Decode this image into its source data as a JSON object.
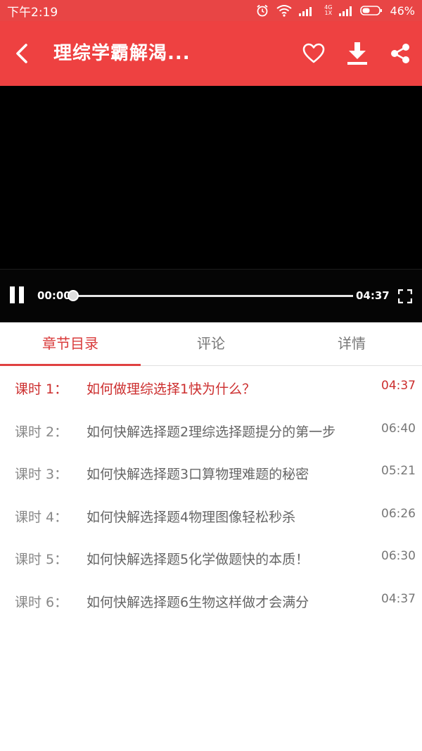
{
  "status_bar": {
    "time": "下午2:19",
    "network": "4G",
    "network_sub": "1X",
    "battery": "46%",
    "icons": [
      "alarm-icon",
      "wifi-icon",
      "signal-icon",
      "signal-icon",
      "battery-icon"
    ]
  },
  "header": {
    "title": "理综学霸解渴...",
    "icons": [
      "back-arrow-icon",
      "heart-icon",
      "download-icon",
      "share-icon"
    ]
  },
  "player": {
    "current_time": "00:00",
    "total_time": "04:37",
    "progress": 0,
    "icons": [
      "pause-icon",
      "fullscreen-icon"
    ]
  },
  "tabs": [
    {
      "label": "章节目录",
      "active": true
    },
    {
      "label": "评论",
      "active": false
    },
    {
      "label": "详情",
      "active": false
    }
  ],
  "lessons": [
    {
      "num": "课时 1：",
      "title": "如何做理综选择1快为什么？",
      "duration": "04:37",
      "active": true
    },
    {
      "num": "课时 2：",
      "title": "如何快解选择题2理综选择题提分的第一步",
      "duration": "06:40",
      "active": false
    },
    {
      "num": "课时 3：",
      "title": "如何快解选择题3口算物理难题的秘密",
      "duration": "05:21",
      "active": false
    },
    {
      "num": "课时 4：",
      "title": "如何快解选择题4物理图像轻松秒杀",
      "duration": "06:26",
      "active": false
    },
    {
      "num": "课时 5：",
      "title": "如何快解选择题5化学做题快的本质！",
      "duration": "06:30",
      "active": false
    },
    {
      "num": "课时 6：",
      "title": "如何快解选择题6生物这样做才会满分",
      "duration": "04:37",
      "active": false
    }
  ],
  "colors": {
    "accent": "#ee4141",
    "active_text": "#cc2e2e",
    "video_bg": "#000000"
  }
}
